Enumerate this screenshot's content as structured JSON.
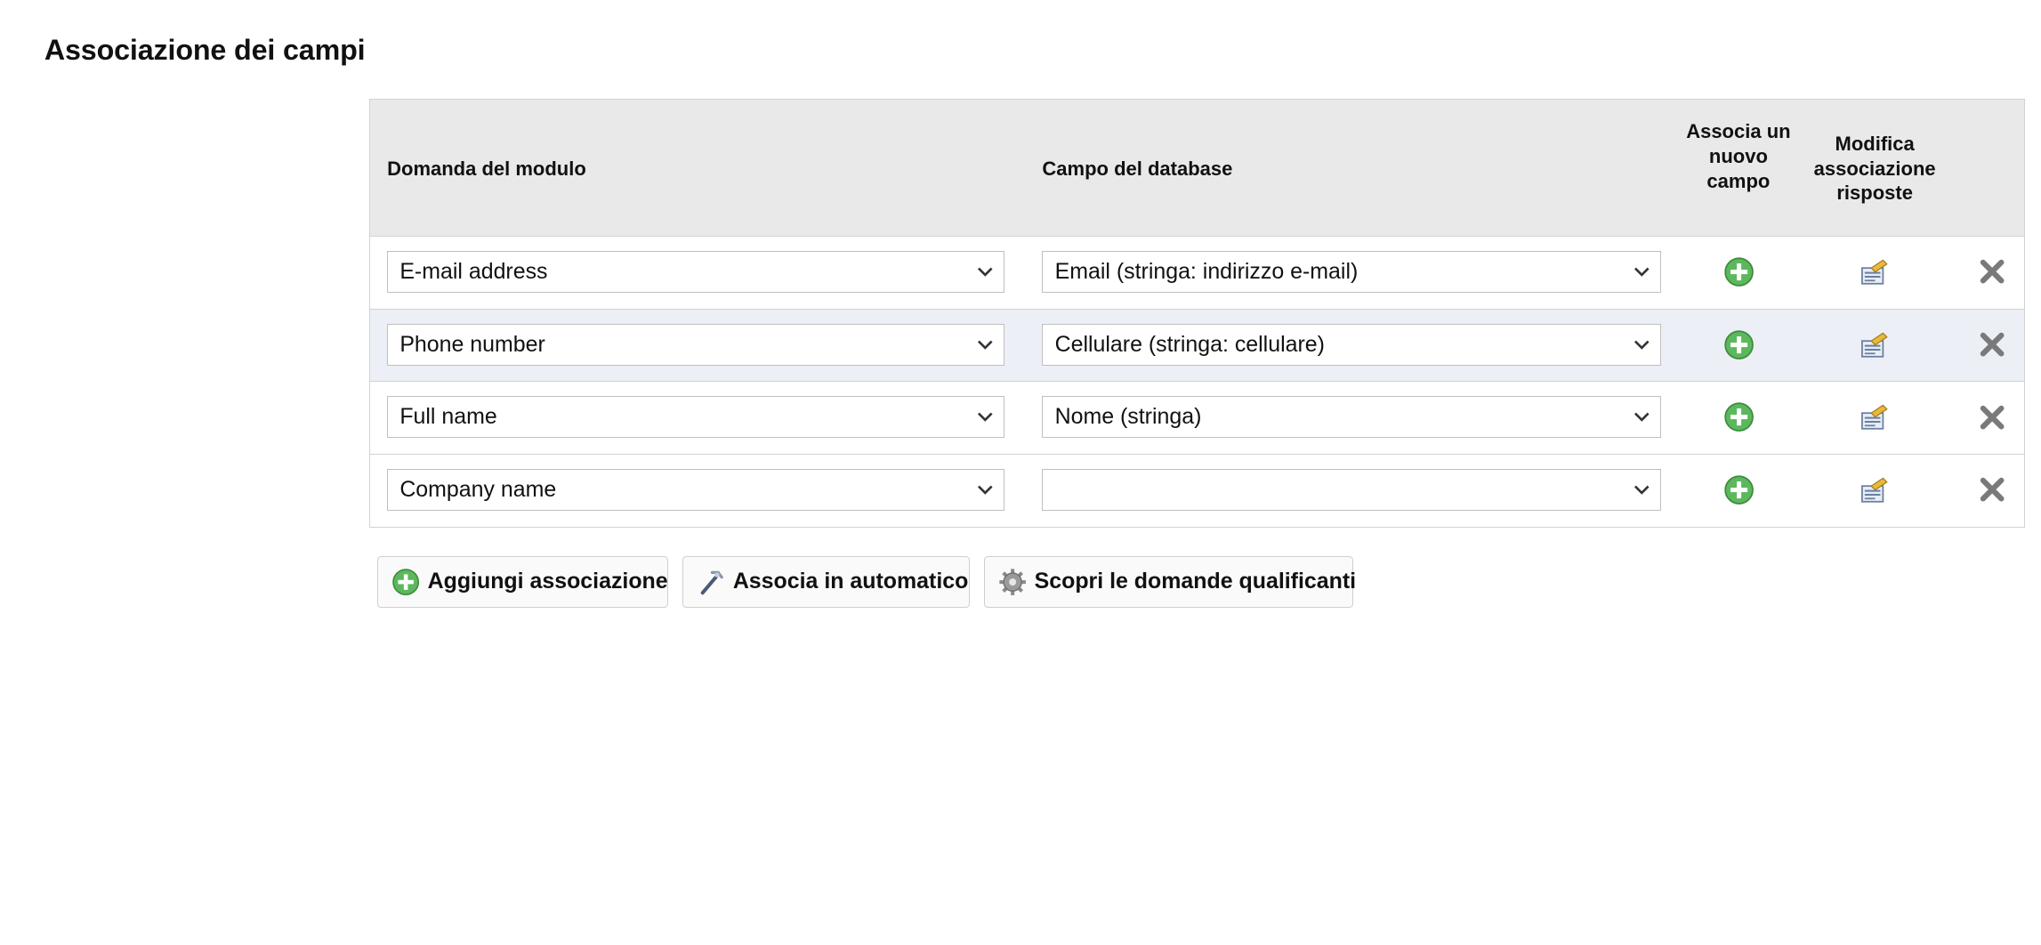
{
  "page": {
    "title": "Associazione dei campi"
  },
  "table": {
    "headers": {
      "form_question": "Domanda del modulo",
      "db_field": "Campo del database",
      "associate_new": "Associa un nuovo campo",
      "edit_answers": "Modifica associazione risposte"
    },
    "rows": [
      {
        "form_question": "E-mail address",
        "db_field": "Email (stringa: indirizzo e-mail)"
      },
      {
        "form_question": "Phone number",
        "db_field": "Cellulare (stringa: cellulare)"
      },
      {
        "form_question": "Full name",
        "db_field": "Nome (stringa)"
      },
      {
        "form_question": "Company name",
        "db_field": ""
      }
    ],
    "icons": {
      "add": "plus-circle-icon",
      "edit": "edit-mapping-icon",
      "delete": "close-icon"
    }
  },
  "actions": {
    "add_label": "Aggiungi associazione",
    "auto_label": "Associa in automatico",
    "discover_label": "Scopri le domande qualificanti"
  },
  "colors": {
    "header_bg": "#e9e9e9",
    "row_alt_bg": "#eceff5",
    "plus_green": "#5cb85c",
    "delete_gray": "#7a7a7a"
  }
}
